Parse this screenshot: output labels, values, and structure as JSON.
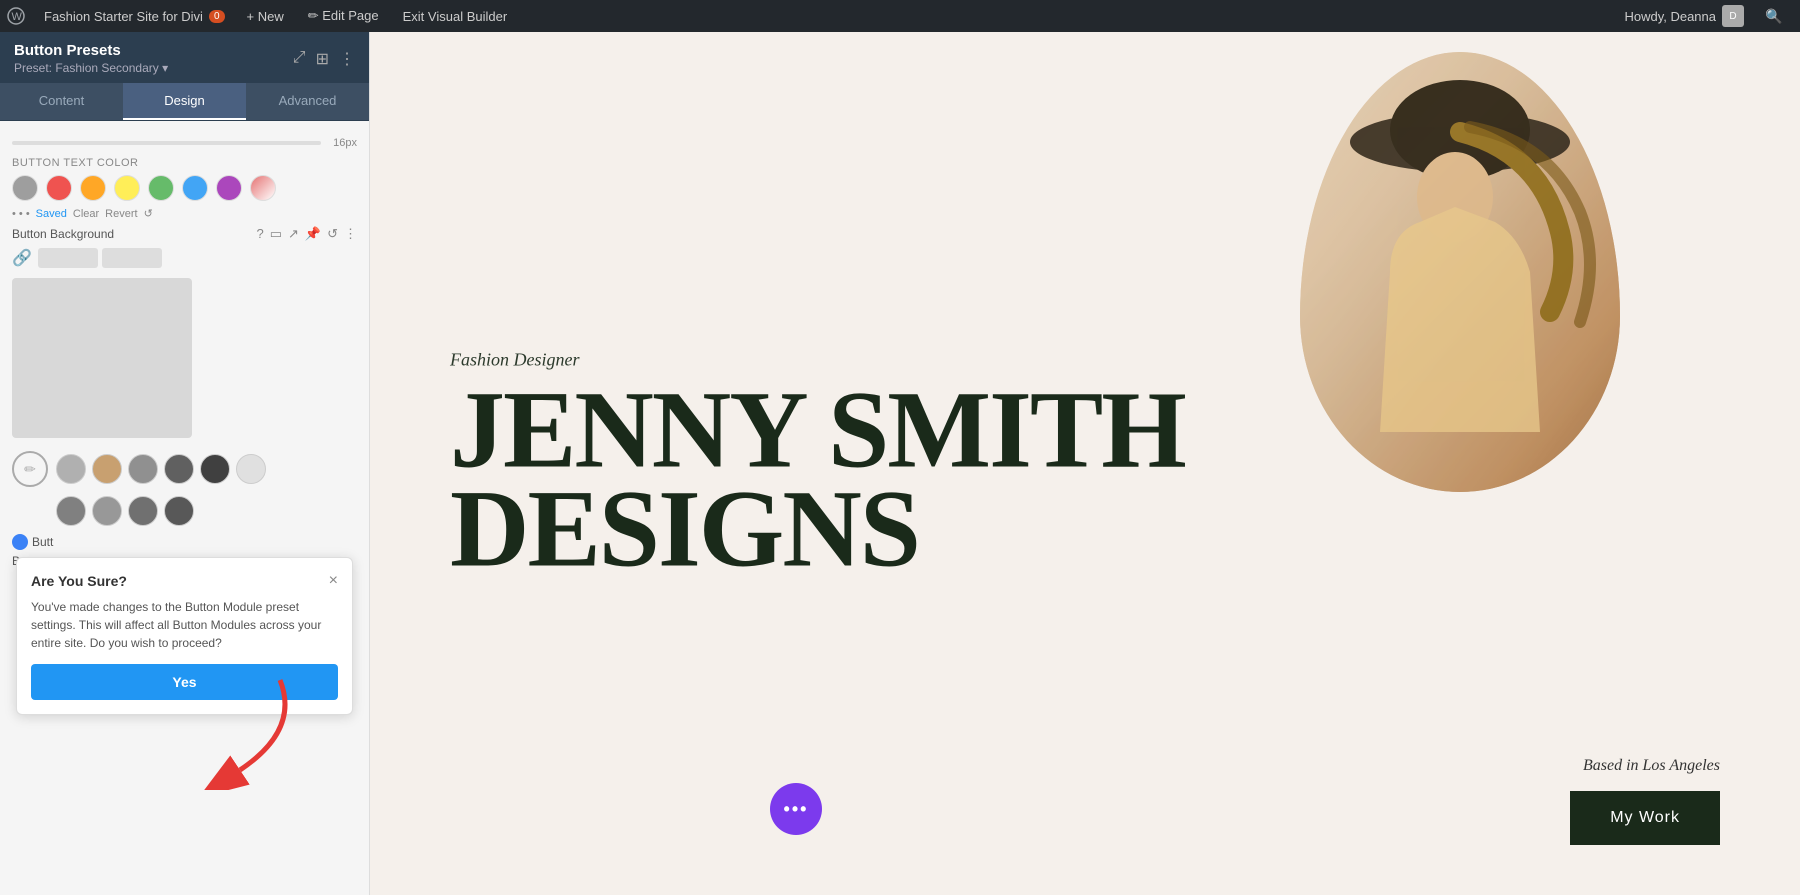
{
  "admin_bar": {
    "wp_icon": "⊞",
    "site_name": "Fashion Starter Site for Divi",
    "comment_count": "0",
    "new_label": "+ New",
    "edit_page_label": "✏ Edit Page",
    "exit_builder_label": "Exit Visual Builder",
    "howdy_text": "Howdy, Deanna",
    "search_icon": "🔍"
  },
  "panel": {
    "title": "Button Presets",
    "subtitle": "Preset: Fashion Secondary ▾",
    "tabs": [
      "Content",
      "Design",
      "Advanced"
    ],
    "active_tab": "Design",
    "sections": {
      "button_text_color_label": "Button Text Color",
      "button_background_label": "Button Background",
      "saved_label": "Saved",
      "clear_label": "Clear",
      "revert_label": "Revert"
    }
  },
  "color_swatches": [
    {
      "color": "#9e9e9e",
      "name": "gray"
    },
    {
      "color": "#ef5350",
      "name": "red"
    },
    {
      "color": "#ffa726",
      "name": "orange"
    },
    {
      "color": "#ffee58",
      "name": "yellow"
    },
    {
      "color": "#66bb6a",
      "name": "green"
    },
    {
      "color": "#42a5f5",
      "name": "blue"
    },
    {
      "color": "#ab47bc",
      "name": "purple"
    },
    {
      "color": "#e57373",
      "name": "pink-light"
    }
  ],
  "gradient_circles": [
    {
      "color": "#b0b0b0",
      "name": "gray1"
    },
    {
      "color": "#c8a070",
      "name": "tan"
    },
    {
      "color": "#909090",
      "name": "gray2"
    },
    {
      "color": "#606060",
      "name": "dark-gray"
    },
    {
      "color": "#404040",
      "name": "darker-gray"
    },
    {
      "color": "#e0e0e0",
      "name": "light-gray"
    }
  ],
  "gradient_circles2": [
    {
      "color": "#808080",
      "name": "mid-gray1"
    },
    {
      "color": "#989898",
      "name": "mid-gray2"
    },
    {
      "color": "#707070",
      "name": "mid-gray3"
    },
    {
      "color": "#585858",
      "name": "mid-gray4"
    }
  ],
  "confirm_dialog": {
    "title": "Are You Sure?",
    "body": "You've made changes to the Button Module preset settings. This will affect all Button Modules across your entire site. Do you wish to proceed?",
    "yes_button": "Yes",
    "close_icon": "×"
  },
  "hero": {
    "fashion_label": "Fashion Designer",
    "name_line1": "JENNY SMITH",
    "name_line2": "DESIGNS",
    "based_in": "Based in Los Angeles",
    "my_work_btn": "My Work",
    "dots_icon": "•••"
  },
  "icons": {
    "maximize": "⤢",
    "grid": "⊞",
    "ellipsis": "⋮",
    "question": "?",
    "mobile": "📱",
    "arrow_up_right": "↗",
    "pin": "📌",
    "undo": "↺",
    "more_vert": "⋮",
    "link_off": "🔗",
    "pencil": "✏"
  }
}
